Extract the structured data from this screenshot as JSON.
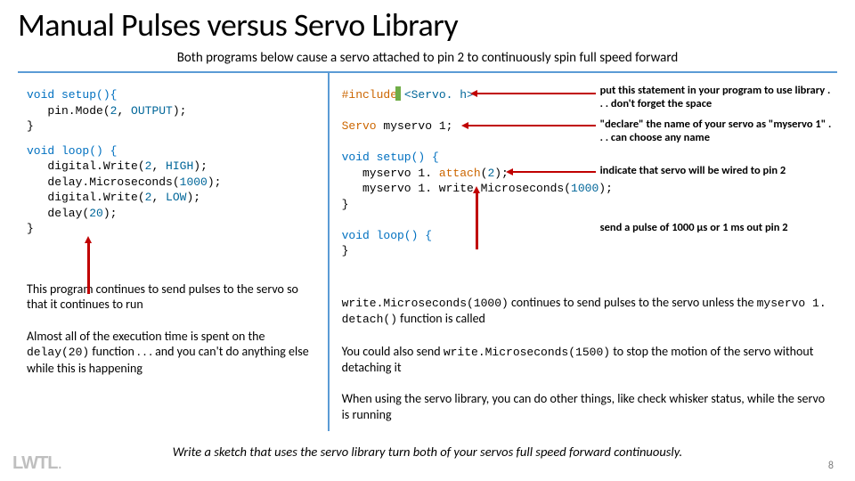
{
  "title": "Manual Pulses versus Servo Library",
  "subtitle": "Both programs below cause a servo attached to pin 2 to continuously spin full speed forward",
  "left": {
    "code_setup_l1": "void setup(){",
    "code_setup_l2": "   pin.Mode(2, OUTPUT);",
    "code_setup_l3": "}",
    "code_loop_l1": "void loop() {",
    "code_loop_l2": "   digital.Write(2, HIGH);",
    "code_loop_l3": "   delay.Microseconds(1000);",
    "code_loop_l4": "   digital.Write(2, LOW);",
    "code_loop_l5": "   delay(20);",
    "code_loop_l6": "}",
    "note1_a": "This program continues to send pulses to the servo so that it continues to run",
    "note2_a": "Almost all of the execution time is spent on the ",
    "note2_code": "delay(20)",
    "note2_b": " function . . . and you can't do anything else while this is happening"
  },
  "right": {
    "code_l1_a": "#include ",
    "code_l1_b": "<Servo. h>",
    "code_l2": "Servo myservo 1;",
    "code_l3": "void setup() {",
    "code_l4": "   myservo 1. attach(2);",
    "code_l5": "   myservo 1. write.Microseconds(1000);",
    "code_l6": "}",
    "code_l7": "void loop() {",
    "code_l8": "}",
    "ann_include": "put this statement in your program to use library . . . don't forget the space",
    "ann_declare": "\"declare\" the name of your servo as \"myservo 1\" . . . can choose any name",
    "ann_attach": "indicate that servo will be wired to pin 2",
    "ann_pulse": "send a pulse of 1000 μs or 1 ms out pin 2",
    "note1_code": "write.Microseconds(1000)",
    "note1_a": " continues to send pulses to the servo unless the ",
    "note1_code2": "myservo 1. detach()",
    "note1_b": " function is called",
    "note2_a": "You could also send ",
    "note2_code": "write.Microseconds(1500)",
    "note2_b": " to stop the motion of the servo without detaching it",
    "note3": "When using the servo library, you can do other things, like check whisker status, while the servo is running"
  },
  "footer": "Write a sketch that uses the servo library turn both of your servos full speed forward continuously.",
  "pagenum": "8",
  "logo": "LWTL"
}
